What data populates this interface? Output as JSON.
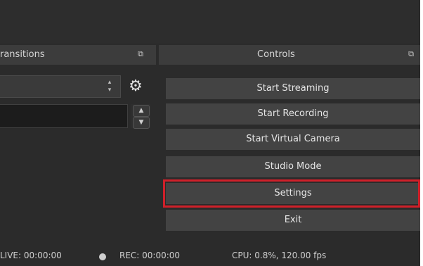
{
  "transitions": {
    "header_title": "ransitions",
    "float_icon": "undock-icon"
  },
  "controls": {
    "header_title": "Controls",
    "float_icon": "undock-icon",
    "buttons": [
      {
        "label": "Start Streaming"
      },
      {
        "label": "Start Recording"
      },
      {
        "label": "Start Virtual Camera"
      },
      {
        "label": "Studio Mode"
      },
      {
        "label": "Settings",
        "highlighted": true
      },
      {
        "label": "Exit"
      }
    ]
  },
  "statusbar": {
    "live_time": "LIVE: 00:00:00",
    "rec_time": "REC: 00:00:00",
    "cpu": "CPU: 0.8%, 120.00 fps"
  },
  "colors": {
    "background": "#2b2b2b",
    "panel_header": "#3c3c3c",
    "button": "#434343",
    "highlight": "#d0202a"
  }
}
